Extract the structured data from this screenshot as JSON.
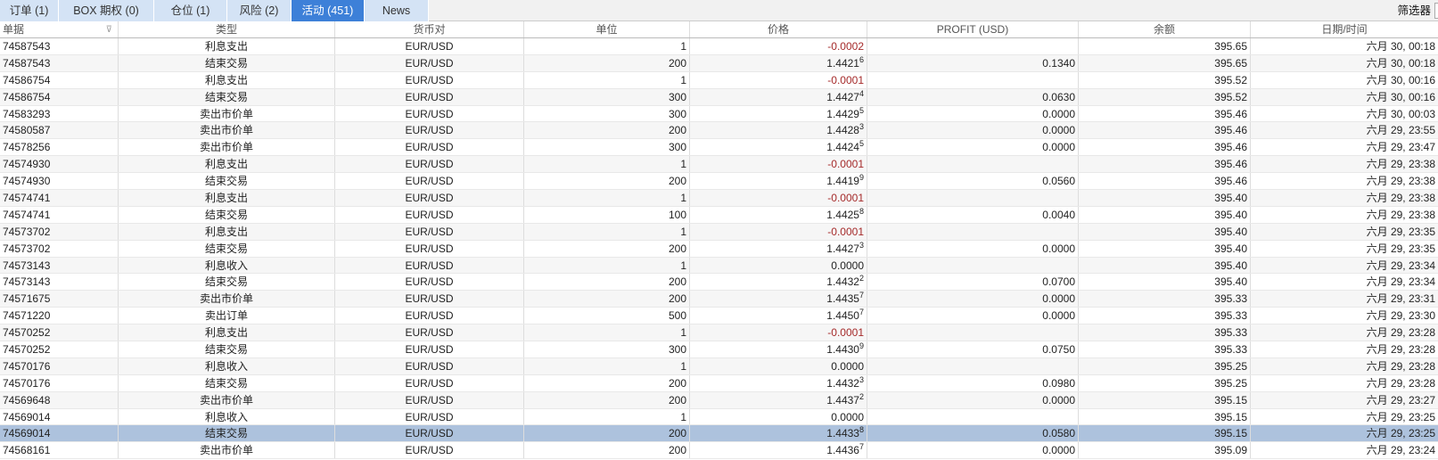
{
  "tabs": [
    {
      "label": "订单 (1)"
    },
    {
      "label": "BOX 期权 (0)"
    },
    {
      "label": "仓位 (1)"
    },
    {
      "label": "风险 (2)"
    },
    {
      "label": "活动 (451)",
      "active": true
    },
    {
      "label": "News"
    }
  ],
  "filter_label": "筛选器",
  "columns": [
    "单据",
    "类型",
    "货币对",
    "单位",
    "价格",
    "PROFIT (USD)",
    "余额",
    "日期/时间"
  ],
  "sort_icon": "filter-funnel-icon",
  "rows": [
    [
      "74587543",
      "利息支出",
      "EUR/USD",
      "1",
      "-0.0002",
      "",
      "",
      "395.65",
      "六月 30, 00:18"
    ],
    [
      "74587543",
      "结束交易",
      "EUR/USD",
      "200",
      "1.4421",
      "6",
      "0.1340",
      "395.65",
      "六月 30, 00:18"
    ],
    [
      "74586754",
      "利息支出",
      "EUR/USD",
      "1",
      "-0.0001",
      "",
      "",
      "395.52",
      "六月 30, 00:16"
    ],
    [
      "74586754",
      "结束交易",
      "EUR/USD",
      "300",
      "1.4427",
      "4",
      "0.0630",
      "395.52",
      "六月 30, 00:16"
    ],
    [
      "74583293",
      "卖出市价单",
      "EUR/USD",
      "300",
      "1.4429",
      "5",
      "0.0000",
      "395.46",
      "六月 30, 00:03"
    ],
    [
      "74580587",
      "卖出市价单",
      "EUR/USD",
      "200",
      "1.4428",
      "3",
      "0.0000",
      "395.46",
      "六月 29, 23:55"
    ],
    [
      "74578256",
      "卖出市价单",
      "EUR/USD",
      "300",
      "1.4424",
      "5",
      "0.0000",
      "395.46",
      "六月 29, 23:47"
    ],
    [
      "74574930",
      "利息支出",
      "EUR/USD",
      "1",
      "-0.0001",
      "",
      "",
      "395.46",
      "六月 29, 23:38"
    ],
    [
      "74574930",
      "结束交易",
      "EUR/USD",
      "200",
      "1.4419",
      "9",
      "0.0560",
      "395.46",
      "六月 29, 23:38"
    ],
    [
      "74574741",
      "利息支出",
      "EUR/USD",
      "1",
      "-0.0001",
      "",
      "",
      "395.40",
      "六月 29, 23:38"
    ],
    [
      "74574741",
      "结束交易",
      "EUR/USD",
      "100",
      "1.4425",
      "8",
      "0.0040",
      "395.40",
      "六月 29, 23:38"
    ],
    [
      "74573702",
      "利息支出",
      "EUR/USD",
      "1",
      "-0.0001",
      "",
      "",
      "395.40",
      "六月 29, 23:35"
    ],
    [
      "74573702",
      "结束交易",
      "EUR/USD",
      "200",
      "1.4427",
      "3",
      "0.0000",
      "395.40",
      "六月 29, 23:35"
    ],
    [
      "74573143",
      "利息收入",
      "EUR/USD",
      "1",
      "0.0000",
      "",
      "",
      "395.40",
      "六月 29, 23:34"
    ],
    [
      "74573143",
      "结束交易",
      "EUR/USD",
      "200",
      "1.4432",
      "2",
      "0.0700",
      "395.40",
      "六月 29, 23:34"
    ],
    [
      "74571675",
      "卖出市价单",
      "EUR/USD",
      "200",
      "1.4435",
      "7",
      "0.0000",
      "395.33",
      "六月 29, 23:31"
    ],
    [
      "74571220",
      "卖出订单",
      "EUR/USD",
      "500",
      "1.4450",
      "7",
      "0.0000",
      "395.33",
      "六月 29, 23:30"
    ],
    [
      "74570252",
      "利息支出",
      "EUR/USD",
      "1",
      "-0.0001",
      "",
      "",
      "395.33",
      "六月 29, 23:28"
    ],
    [
      "74570252",
      "结束交易",
      "EUR/USD",
      "300",
      "1.4430",
      "9",
      "0.0750",
      "395.33",
      "六月 29, 23:28"
    ],
    [
      "74570176",
      "利息收入",
      "EUR/USD",
      "1",
      "0.0000",
      "",
      "",
      "395.25",
      "六月 29, 23:28"
    ],
    [
      "74570176",
      "结束交易",
      "EUR/USD",
      "200",
      "1.4432",
      "3",
      "0.0980",
      "395.25",
      "六月 29, 23:28"
    ],
    [
      "74569648",
      "卖出市价单",
      "EUR/USD",
      "200",
      "1.4437",
      "2",
      "0.0000",
      "395.15",
      "六月 29, 23:27"
    ],
    [
      "74569014",
      "利息收入",
      "EUR/USD",
      "1",
      "0.0000",
      "",
      "",
      "395.15",
      "六月 29, 23:25"
    ],
    [
      "74569014",
      "结束交易",
      "EUR/USD",
      "200",
      "1.4433",
      "8",
      "0.0580",
      "395.15",
      "六月 29, 23:25"
    ],
    [
      "74568161",
      "卖出市价单",
      "EUR/USD",
      "200",
      "1.4436",
      "7",
      "0.0000",
      "395.09",
      "六月 29, 23:24"
    ]
  ],
  "selected_row": 23,
  "colors": {
    "tab": "#d4e3f5",
    "tab_active": "#3d80d8",
    "selected": "#adc2dd",
    "negative": "#a52a2a"
  }
}
